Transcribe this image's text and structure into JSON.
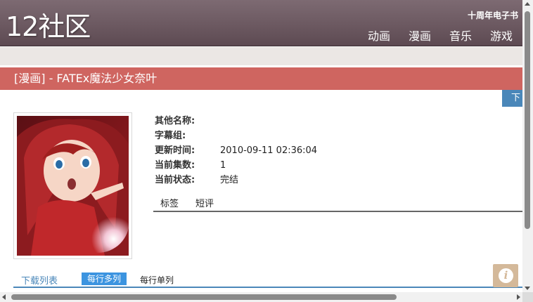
{
  "header": {
    "logo": "12社区",
    "anniversary": "十周年电子书",
    "nav": [
      "动画",
      "漫画",
      "音乐",
      "游戏"
    ]
  },
  "title_bar": {
    "title": "[漫画] - FATEx魔法少女奈叶"
  },
  "download_tab": {
    "label": "下"
  },
  "cover": {
    "alt_icon": "anime-cover-image"
  },
  "info": {
    "rows": [
      {
        "label": "其他名称:",
        "value": ""
      },
      {
        "label": "字幕组:",
        "value": ""
      },
      {
        "label": "更新时间:",
        "value": "2010-09-11 02:36:04"
      },
      {
        "label": "当前集数:",
        "value": "1"
      },
      {
        "label": "当前状态:",
        "value": "完结"
      }
    ]
  },
  "tabs": [
    "标签",
    "短评"
  ],
  "download_list": {
    "label": "下载列表",
    "mode_multi": "每行多列",
    "mode_single": "每行单列"
  },
  "colors": {
    "header": "#6c5961",
    "title_bar": "#cf6560",
    "accent_blue": "#4a87b9",
    "info_button": "#d4b99a"
  },
  "icons": {
    "info_button": "info-icon"
  }
}
